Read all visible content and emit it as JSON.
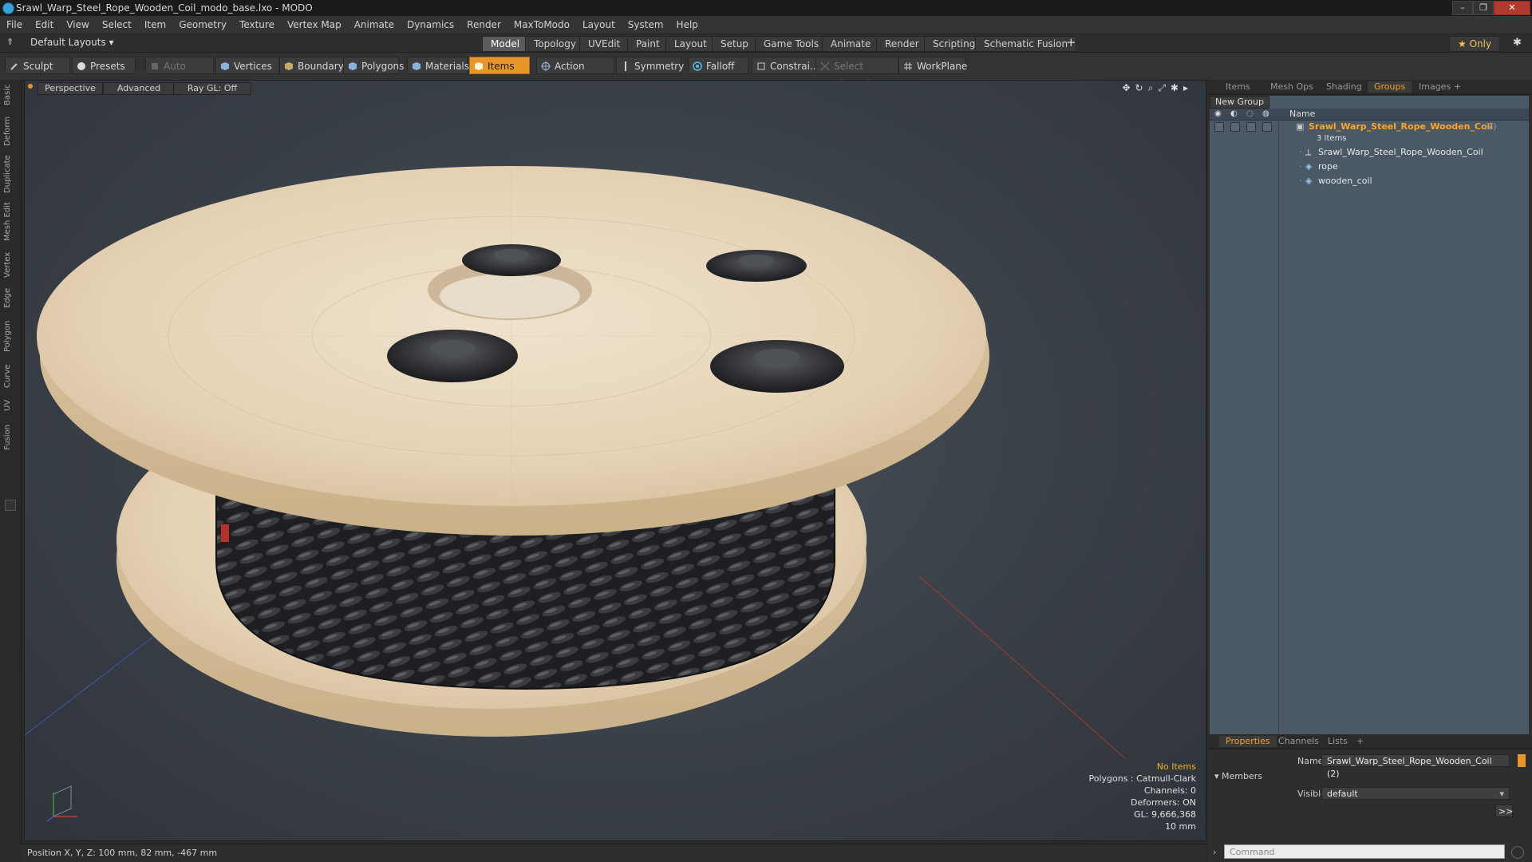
{
  "window": {
    "title": "Srawl_Warp_Steel_Rope_Wooden_Coil_modo_base.lxo - MODO",
    "minimize": "–",
    "restore": "❐",
    "close": "✕"
  },
  "menu": [
    "File",
    "Edit",
    "View",
    "Select",
    "Item",
    "Geometry",
    "Texture",
    "Vertex Map",
    "Animate",
    "Dynamics",
    "Render",
    "MaxToModo",
    "Layout",
    "System",
    "Help"
  ],
  "layouts": {
    "selector": "Default Layouts ▾",
    "tabs": [
      "Model",
      "Topology",
      "UVEdit",
      "Paint",
      "Layout",
      "Setup",
      "Game Tools",
      "Animate",
      "Render",
      "Scripting",
      "Schematic Fusion"
    ],
    "active": "Model",
    "add": "+",
    "only": "★  Only",
    "gear": "✱"
  },
  "toolbar": {
    "sculpt": "Sculpt",
    "presets": "Presets",
    "auto_select": "Auto Select",
    "vertices": "Vertices",
    "boundary": "Boundary",
    "polygons": "Polygons",
    "materials": "Materials",
    "items": "Items",
    "action_center": "Action Center",
    "symmetry": "Symmetry",
    "falloff": "Falloff",
    "constraints": "Constrai...",
    "select_through": "Select Through",
    "workplane": "WorkPlane"
  },
  "left_tabs": [
    "Basic",
    "Deform",
    "Duplicate",
    "Mesh Edit",
    "Vertex",
    "Edge",
    "Polygon",
    "Curve",
    "UV",
    "Fusion"
  ],
  "viewport": {
    "view": "Perspective",
    "shading": "Advanced",
    "raygl": "Ray GL: Off",
    "hud": {
      "no_items": "No Items",
      "polygons": "Polygons : Catmull-Clark",
      "channels": "Channels: 0",
      "deformers": "Deformers: ON",
      "gl": "GL: 9,666,368",
      "scale": "10 mm"
    }
  },
  "status": {
    "position": "Position X, Y, Z:  100 mm, 82 mm, -467 mm"
  },
  "right_panel": {
    "tabs": [
      "Items",
      "Mesh Ops",
      "Shading",
      "Groups",
      "Images"
    ],
    "active_tab": "Groups",
    "new_group": "New Group",
    "column_name": "Name",
    "group_name": "Srawl_Warp_Steel_Rope_Wooden_Coil",
    "group_count": "(2)",
    "group_sub": "3 Items",
    "members": [
      "Srawl_Warp_Steel_Rope_Wooden_Coil",
      "rope",
      "wooden_coil"
    ]
  },
  "properties": {
    "tabs": [
      "Properties",
      "Channels",
      "Lists"
    ],
    "active_tab": "Properties",
    "name_label": "Name",
    "name_value": "Srawl_Warp_Steel_Rope_Wooden_Coil (2)",
    "members_section": "Members",
    "visible_label": "Visible",
    "visible_value": "default",
    "more": ">>",
    "command_placeholder": "Command"
  }
}
